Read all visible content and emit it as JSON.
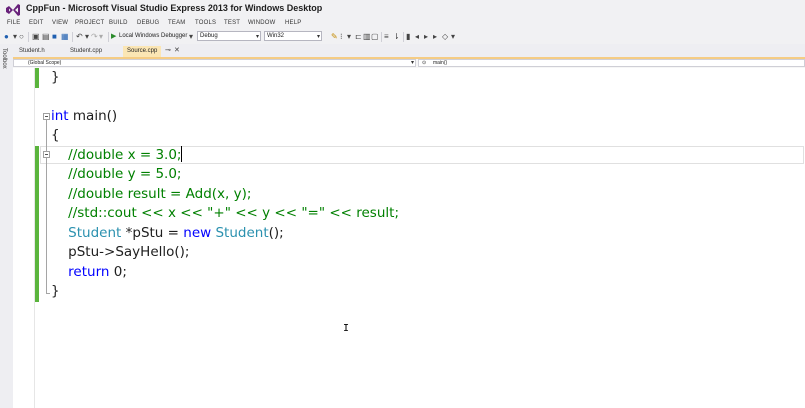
{
  "window": {
    "title": "CppFun - Microsoft Visual Studio Express 2013 for Windows Desktop"
  },
  "menu": [
    "FILE",
    "EDIT",
    "VIEW",
    "PROJECT",
    "BUILD",
    "DEBUG",
    "TEAM",
    "TOOLS",
    "TEST",
    "WINDOW",
    "HELP"
  ],
  "toolbar": {
    "debugger_label": "Local Windows Debugger",
    "configuration": "Debug",
    "platform": "Win32"
  },
  "toolbox": {
    "label": "Toolbox"
  },
  "tabs": [
    {
      "label": "Student.h",
      "active": false
    },
    {
      "label": "Student.cpp",
      "active": false
    },
    {
      "label": "Source.cpp",
      "active": true
    }
  ],
  "navbar": {
    "scope": "(Global Scope)",
    "member": "main()"
  },
  "code": [
    {
      "tokens": [
        {
          "t": "}",
          "c": "p"
        }
      ]
    },
    {
      "tokens": []
    },
    {
      "tokens": [
        {
          "t": "int",
          "c": "kw"
        },
        {
          "t": " main()",
          "c": "p"
        }
      ]
    },
    {
      "tokens": [
        {
          "t": "{",
          "c": "p"
        }
      ]
    },
    {
      "tokens": [
        {
          "t": "    //double x = 3.0;",
          "c": "cm"
        }
      ],
      "caret": true
    },
    {
      "tokens": [
        {
          "t": "    //double y = 5.0;",
          "c": "cm"
        }
      ]
    },
    {
      "tokens": [
        {
          "t": "    //double result = Add(x, y);",
          "c": "cm"
        }
      ]
    },
    {
      "tokens": [
        {
          "t": "    //std::cout << x << \"+\" << y << \"=\" << result;",
          "c": "cm"
        }
      ]
    },
    {
      "tokens": [
        {
          "t": "    ",
          "c": "p"
        },
        {
          "t": "Student",
          "c": "ty"
        },
        {
          "t": " *pStu = ",
          "c": "p"
        },
        {
          "t": "new",
          "c": "kw"
        },
        {
          "t": " ",
          "c": "p"
        },
        {
          "t": "Student",
          "c": "ty"
        },
        {
          "t": "();",
          "c": "p"
        }
      ]
    },
    {
      "tokens": [
        {
          "t": "    pStu->SayHello();",
          "c": "p"
        }
      ]
    },
    {
      "tokens": [
        {
          "t": "    ",
          "c": "p"
        },
        {
          "t": "return",
          "c": "kw"
        },
        {
          "t": " 0;",
          "c": "p"
        }
      ]
    },
    {
      "tokens": [
        {
          "t": "}",
          "c": "p"
        }
      ]
    }
  ],
  "colors": {
    "keyword": "#0000ff",
    "comment": "#008000",
    "type": "#2b91af",
    "change_bar": "#5ab43c",
    "active_tab": "#fbe6b4"
  }
}
